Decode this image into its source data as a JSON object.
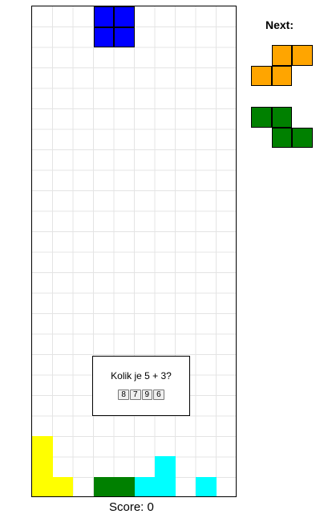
{
  "board": {
    "cols": 10,
    "rows": 24,
    "falling_piece": {
      "shape": "O",
      "color": "#0000ff",
      "cells": [
        [
          3,
          0
        ],
        [
          4,
          0
        ],
        [
          3,
          1
        ],
        [
          4,
          1
        ]
      ]
    },
    "settled_cells": [
      {
        "col": 0,
        "row": 21,
        "color": "#ffff00"
      },
      {
        "col": 0,
        "row": 22,
        "color": "#ffff00"
      },
      {
        "col": 0,
        "row": 23,
        "color": "#ffff00"
      },
      {
        "col": 1,
        "row": 23,
        "color": "#ffff00"
      },
      {
        "col": 3,
        "row": 23,
        "color": "#008000"
      },
      {
        "col": 4,
        "row": 23,
        "color": "#008000"
      },
      {
        "col": 5,
        "row": 23,
        "color": "#00ffff"
      },
      {
        "col": 6,
        "row": 22,
        "color": "#00ffff"
      },
      {
        "col": 6,
        "row": 23,
        "color": "#00ffff"
      },
      {
        "col": 8,
        "row": 23,
        "color": "#00ffff"
      }
    ]
  },
  "dialog": {
    "question": "Kolik je 5 + 3?",
    "answers": [
      "8",
      "7",
      "9",
      "6"
    ]
  },
  "score": {
    "text": "Score: 0"
  },
  "next": {
    "label": "Next:",
    "pieces": [
      {
        "shape": "S",
        "color": "#ffa500",
        "cells": [
          [
            1,
            0
          ],
          [
            2,
            0
          ],
          [
            0,
            1
          ],
          [
            1,
            1
          ]
        ]
      },
      {
        "shape": "Z",
        "color": "#008000",
        "cells": [
          [
            0,
            0
          ],
          [
            1,
            0
          ],
          [
            1,
            1
          ],
          [
            2,
            1
          ]
        ]
      }
    ]
  }
}
